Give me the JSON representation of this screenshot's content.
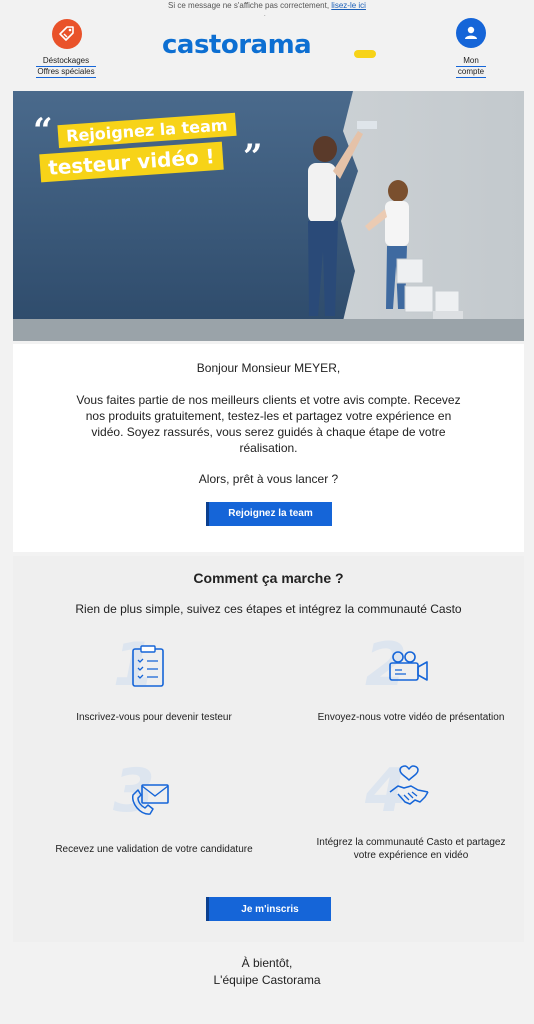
{
  "preheader": {
    "text": "Si ce message ne s'affiche pas correctement,",
    "link": "lisez-le ici",
    "dot": "."
  },
  "header": {
    "logo_text": "castorama",
    "promo_links": [
      "Déstockages",
      "Offres spéciales"
    ],
    "account_links": [
      "Mon",
      "compte"
    ]
  },
  "hero": {
    "tag_line1": "Rejoignez la team",
    "tag_line2": "testeur vidéo !",
    "quote_open": "“",
    "quote_close": "”"
  },
  "intro": {
    "greeting": "Bonjour Monsieur MEYER,",
    "body": "Vous faites partie de nos meilleurs clients et votre avis compte. Recevez nos produits gratuitement, testez-les et partagez votre expérience en vidéo. Soyez rassurés, vous serez guidés à chaque étape de votre réalisation.",
    "question": "Alors, prêt à vous lancer ?",
    "cta": "Rejoignez la team"
  },
  "how": {
    "title": "Comment ça marche ?",
    "subtitle": "Rien de plus simple, suivez ces étapes et intégrez la communauté Casto",
    "steps": [
      {
        "number": "1",
        "icon": "clipboard-icon",
        "text": "Inscrivez-vous pour devenir testeur"
      },
      {
        "number": "2",
        "icon": "video-camera-icon",
        "text": "Envoyez-nous votre vidéo de présentation"
      },
      {
        "number": "3",
        "icon": "phone-mail-icon",
        "text": "Recevez une validation de votre candidature"
      },
      {
        "number": "4",
        "icon": "handshake-heart-icon",
        "text": "Intégrez la communauté Casto et partagez votre expérience en vidéo"
      }
    ],
    "cta": "Je m'inscris"
  },
  "closing": {
    "line1": "À bientôt,",
    "line2": "L'équipe Castorama"
  },
  "colors": {
    "brand_blue": "#1565d8",
    "brand_yellow": "#f7d318",
    "promo_orange": "#e9522a"
  }
}
